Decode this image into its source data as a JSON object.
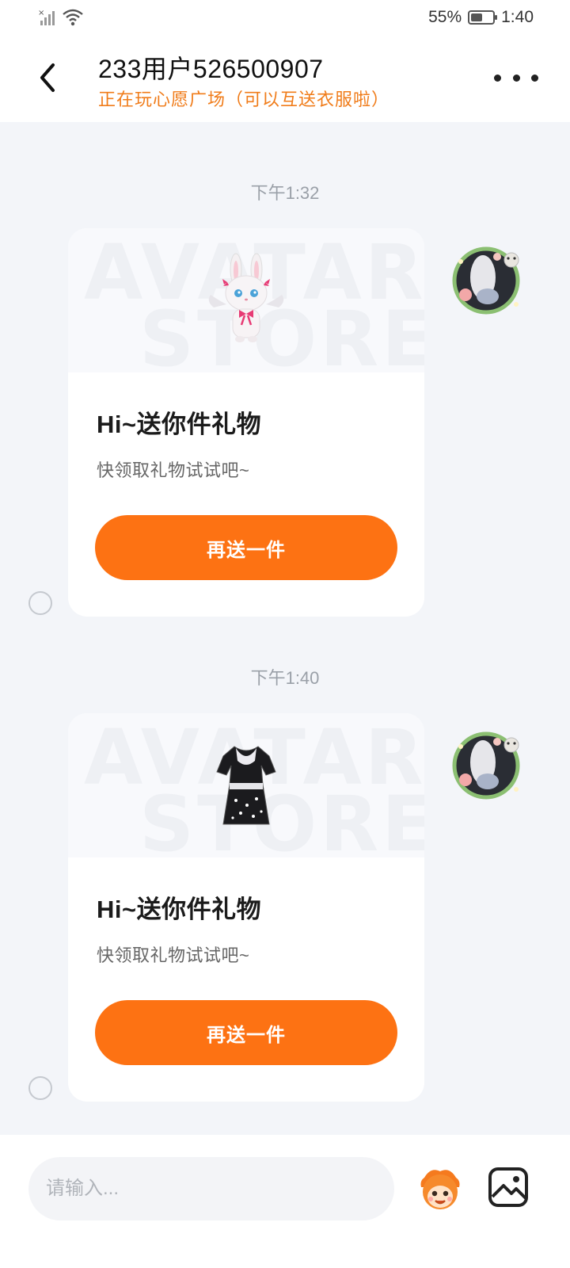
{
  "status_bar": {
    "battery_percent": "55%",
    "time": "1:40",
    "battery_level": 0.55
  },
  "header": {
    "title": "233用户526500907",
    "subtitle": "正在玩心愿广场（可以互送衣服啦）"
  },
  "messages": [
    {
      "timestamp": "下午1:32",
      "card": {
        "watermark_line1": "AVATAR",
        "watermark_line2": "STORE",
        "item_icon": "bunny-plush-icon",
        "title": "Hi~送你件礼物",
        "text": "快领取礼物试试吧~",
        "button_label": "再送一件"
      }
    },
    {
      "timestamp": "下午1:40",
      "card": {
        "watermark_line1": "AVATAR",
        "watermark_line2": "STORE",
        "item_icon": "dress-icon",
        "title": "Hi~送你件礼物",
        "text": "快领取礼物试试吧~",
        "button_label": "再送一件"
      }
    }
  ],
  "composer": {
    "placeholder": "请输入..."
  },
  "colors": {
    "accent": "#fd7213",
    "subtitle": "#f07c1a",
    "background": "#f3f5f9"
  }
}
